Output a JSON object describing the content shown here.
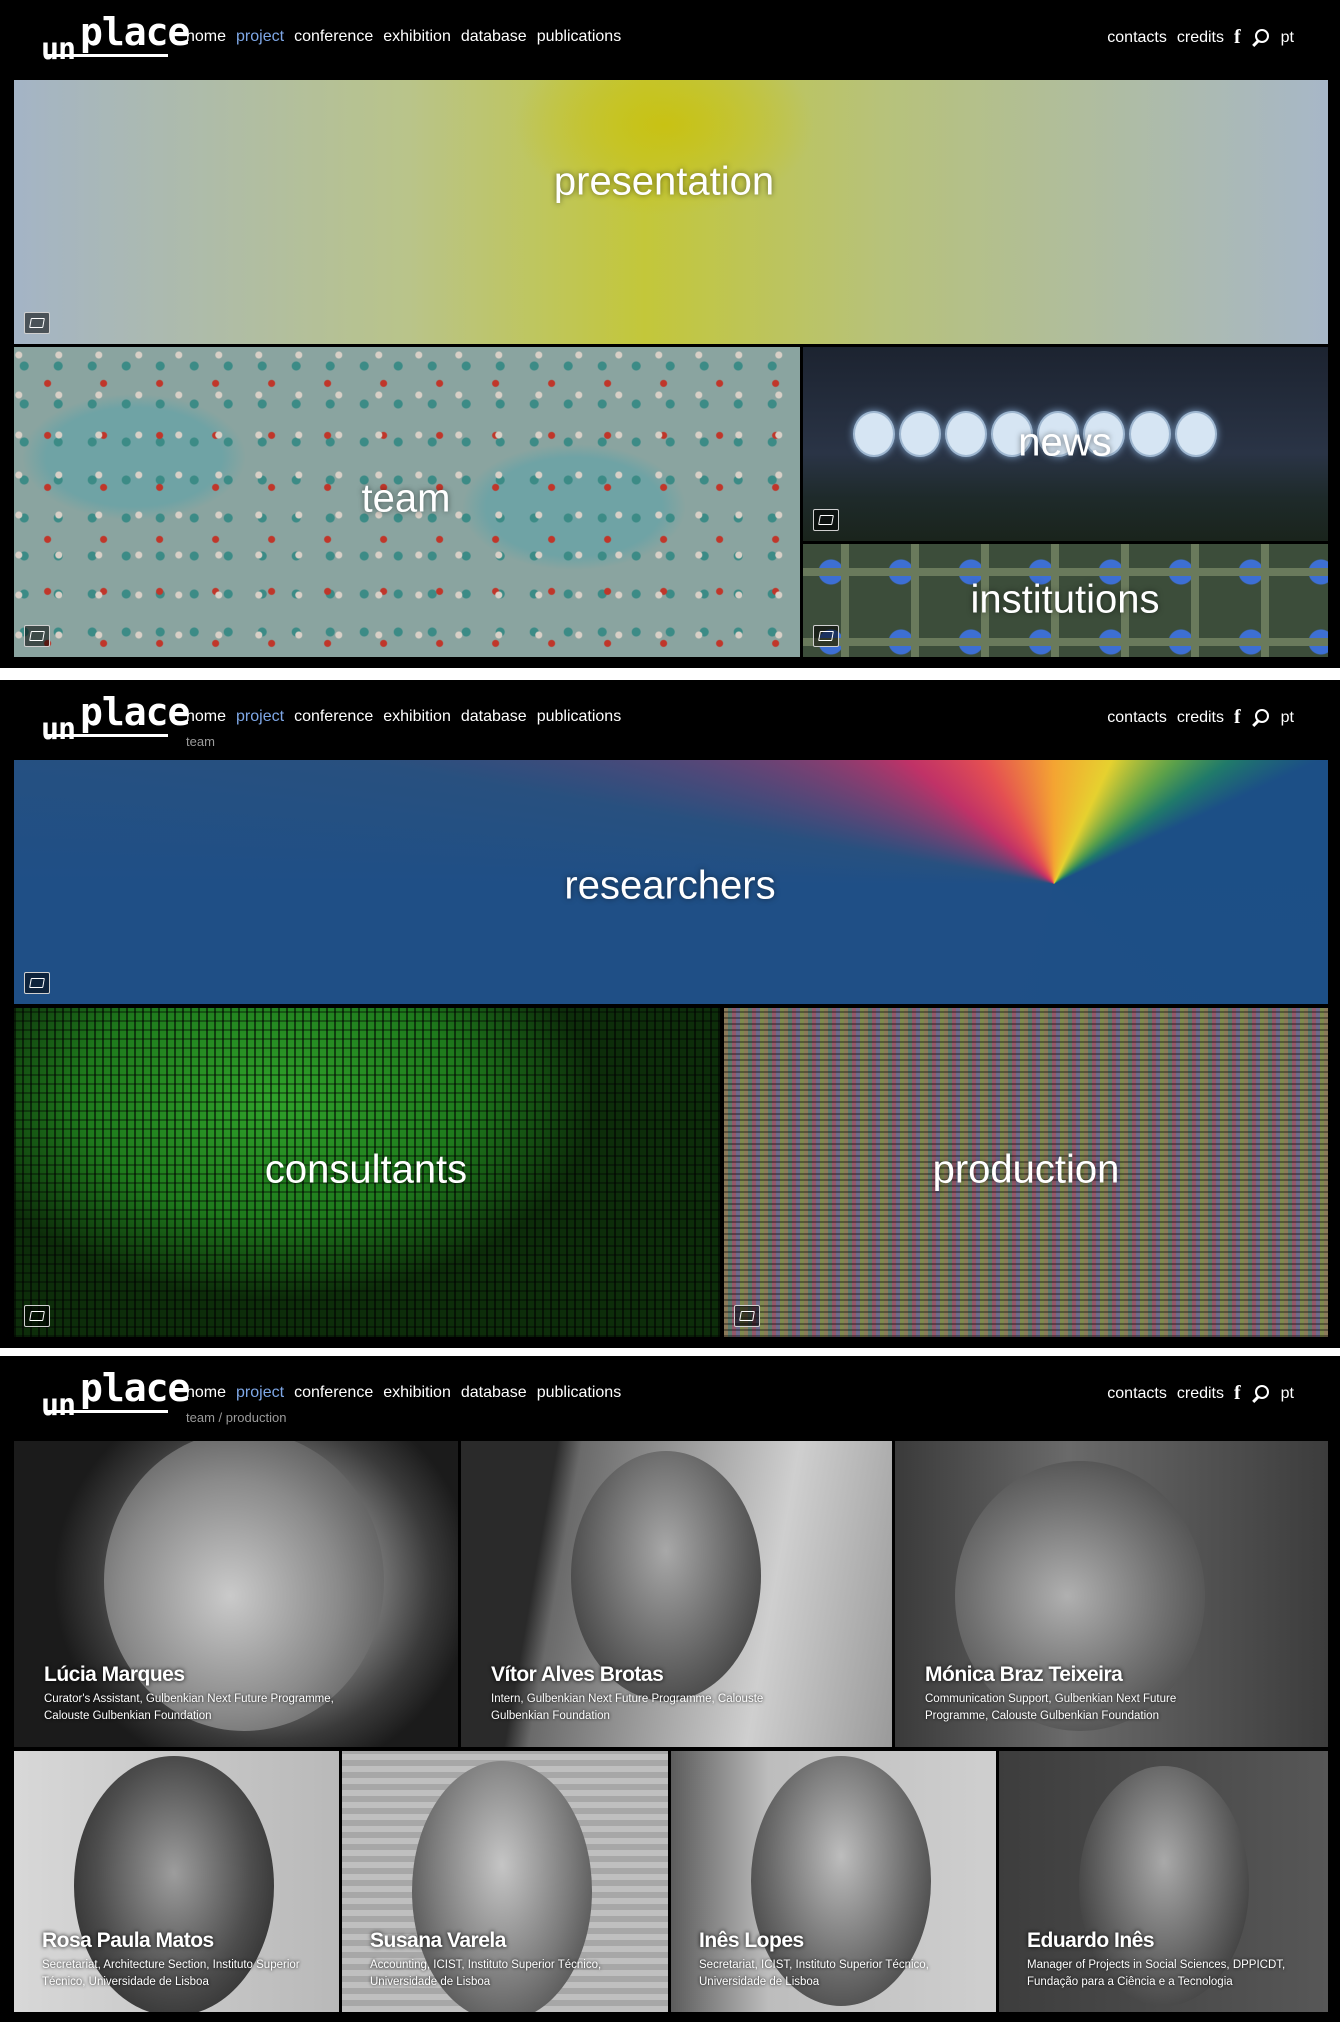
{
  "logo": {
    "prefix": "un",
    "main": "place"
  },
  "nav": {
    "items": [
      "home",
      "project",
      "conference",
      "exhibition",
      "database",
      "publications"
    ],
    "active": "project",
    "right": {
      "contacts": "contacts",
      "credits": "credits",
      "facebook": "f",
      "language": "pt"
    }
  },
  "panel1": {
    "tiles": {
      "presentation": "presentation",
      "team": "team",
      "news": "news",
      "institutions": "institutions"
    }
  },
  "panel2": {
    "breadcrumb": "team",
    "tiles": {
      "researchers": "researchers",
      "consultants": "consultants",
      "production": "production"
    }
  },
  "panel3": {
    "breadcrumb": "team / production",
    "people": [
      {
        "name": "Lúcia Marques",
        "role": "Curator's Assistant, Gulbenkian Next Future Programme, Calouste Gulbenkian Foundation"
      },
      {
        "name": "Vítor Alves Brotas",
        "role": "Intern, Gulbenkian Next Future Programme, Calouste Gulbenkian Foundation"
      },
      {
        "name": "Mónica Braz Teixeira",
        "role": "Communication Support, Gulbenkian Next Future Programme, Calouste Gulbenkian Foundation"
      },
      {
        "name": "Rosa Paula Matos",
        "role": "Secretariat, Architecture Section, Instituto Superior Técnico, Universidade de Lisboa"
      },
      {
        "name": "Susana Varela",
        "role": "Accounting, ICIST, Instituto Superior Técnico, Universidade de Lisboa"
      },
      {
        "name": "Inês Lopes",
        "role": "Secretariat, ICIST, Instituto Superior Técnico, Universidade de Lisboa"
      },
      {
        "name": "Eduardo Inês",
        "role": "Manager of Projects in Social Sciences, DPPICDT, Fundação para a Ciência e a Tecnologia"
      }
    ]
  },
  "colors": {
    "active_link": "#7ea7e6",
    "background": "#000000",
    "breadcrumb": "#9a9a9a"
  }
}
